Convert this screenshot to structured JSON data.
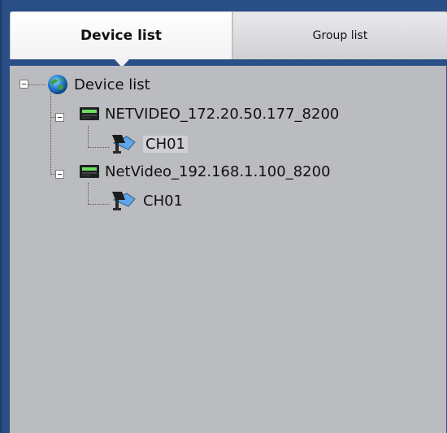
{
  "tabs": {
    "active_label": "Device list",
    "inactive_label": "Group list"
  },
  "tree": {
    "root_label": "Device list",
    "devices": [
      {
        "label": "NETVIDEO_172.20.50.177_8200",
        "channels": [
          "CH01"
        ]
      },
      {
        "label": "NetVideo_192.168.1.100_8200",
        "channels": [
          "CH01"
        ]
      }
    ]
  },
  "icons": {
    "root": "globe-icon",
    "device": "dvr-device-icon",
    "channel": "camera-icon"
  }
}
